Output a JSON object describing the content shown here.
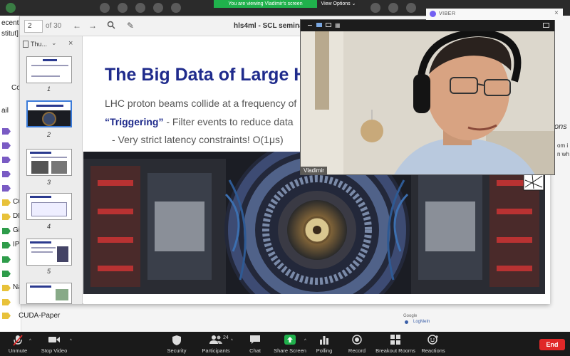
{
  "banner": {
    "sharing_text": "You are viewing Vladimir's screen",
    "view_options": "View Options"
  },
  "background_app": {
    "left_items": [
      "ecent",
      "stitut] R",
      "Co",
      "ail",
      "CC",
      "DM",
      "Git",
      "IPI",
      "Na",
      "CUDA-Paper"
    ],
    "map_labels": [
      "Google",
      "LogMeIn"
    ],
    "right_fragments": [
      "ons",
      "om i",
      "n wh"
    ]
  },
  "pdf_viewer": {
    "page_current": "2",
    "page_total": "of 30",
    "title": "hls4ml - SCL seminar 11",
    "thumbnails_header": "Thu...",
    "thumbnails": [
      {
        "num": "1",
        "selected": false
      },
      {
        "num": "2",
        "selected": true
      },
      {
        "num": "3",
        "selected": false
      },
      {
        "num": "4",
        "selected": false
      },
      {
        "num": "5",
        "selected": false
      }
    ],
    "slide": {
      "title": "The Big Data of Large H",
      "line1": "LHC proton beams collide at a frequency of",
      "line2_emph": "“Triggering”",
      "line2_rest": " - Filter events to reduce data",
      "line3": "-    Very strict latency constraints! O(1μs)"
    }
  },
  "video": {
    "participant_name": "Vladimir"
  },
  "notification": {
    "app": "VIBER"
  },
  "controls": [
    {
      "label": "Unmute",
      "icon": "microphone-muted-icon"
    },
    {
      "label": "Stop Video",
      "icon": "video-camera-icon"
    },
    {
      "label": "Security",
      "icon": "shield-icon"
    },
    {
      "label": "Participants",
      "icon": "participants-icon",
      "count": "24"
    },
    {
      "label": "Chat",
      "icon": "chat-icon"
    },
    {
      "label": "Share Screen",
      "icon": "share-screen-icon"
    },
    {
      "label": "Polling",
      "icon": "polling-icon"
    },
    {
      "label": "Record",
      "icon": "record-icon"
    },
    {
      "label": "Breakout Rooms",
      "icon": "breakout-rooms-icon"
    },
    {
      "label": "Reactions",
      "icon": "reactions-icon"
    }
  ],
  "end_button": "End",
  "colors": {
    "share_green": "#20b14c",
    "end_red": "#e02828",
    "slide_title_blue": "#1f2b8c",
    "thumb_selected": "#3b7bd9"
  }
}
